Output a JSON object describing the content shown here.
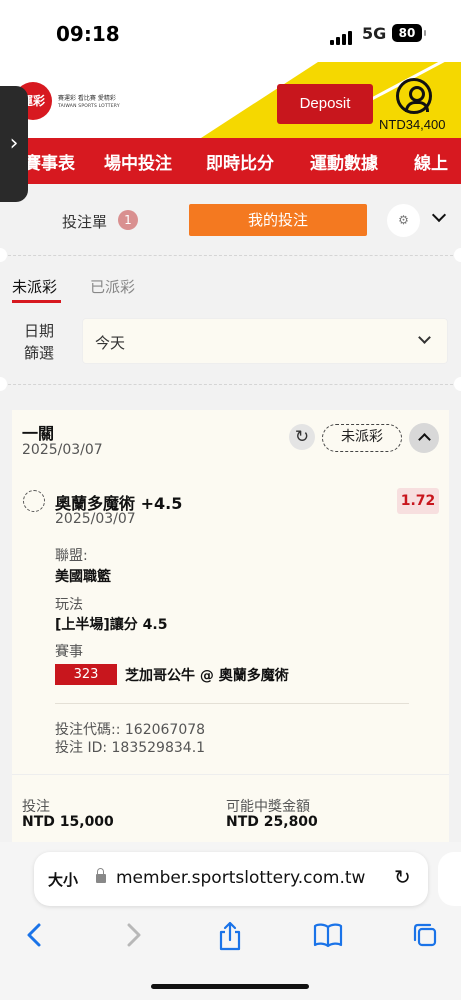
{
  "status_bar": {
    "time": "09:18",
    "network": "5G",
    "battery": "80"
  },
  "header": {
    "logo_mark": "運彩",
    "logo_tagline": "賽運彩 看比賽 愛精彩",
    "logo_subtitle": "TAIWAN SPORTS LOTTERY",
    "deposit_label": "Deposit",
    "balance": "NTD34,400",
    "accent_color": "#d71920",
    "banner_color": "#f5d800"
  },
  "nav": {
    "items": [
      "賽事表",
      "場中投注",
      "即時比分",
      "運動數據",
      "線上"
    ]
  },
  "slip": {
    "label": "投注單",
    "count": "1",
    "my_bets_label": "我的投注",
    "my_bets_color": "#f47920"
  },
  "tabs": {
    "unsettled": "未派彩",
    "settled": "已派彩"
  },
  "filter": {
    "label_line1": "日期",
    "label_line2": "篩選",
    "value": "今天"
  },
  "bet": {
    "type": "一關",
    "date": "2025/03/07",
    "status": "未派彩",
    "selection": "奧蘭多魔術 +4.5",
    "selection_date": "2025/03/07",
    "odds": "1.72",
    "league_label": "聯盟:",
    "league": "美國職籃",
    "market_label": "玩法",
    "market": "[上半場]讓分 4.5",
    "event_label": "賽事",
    "event_id": "323",
    "event": "芝加哥公牛 @ 奧蘭多魔術",
    "code_line": "投注代碼:: 162067078",
    "id_line": "投注 ID: 183529834.1",
    "stake_label": "投注",
    "stake": "NTD 15,000",
    "payout_label": "可能中獎金額",
    "payout": "NTD 25,800"
  },
  "browser": {
    "text_size": "大小",
    "url": "member.sportslottery.com.tw"
  }
}
